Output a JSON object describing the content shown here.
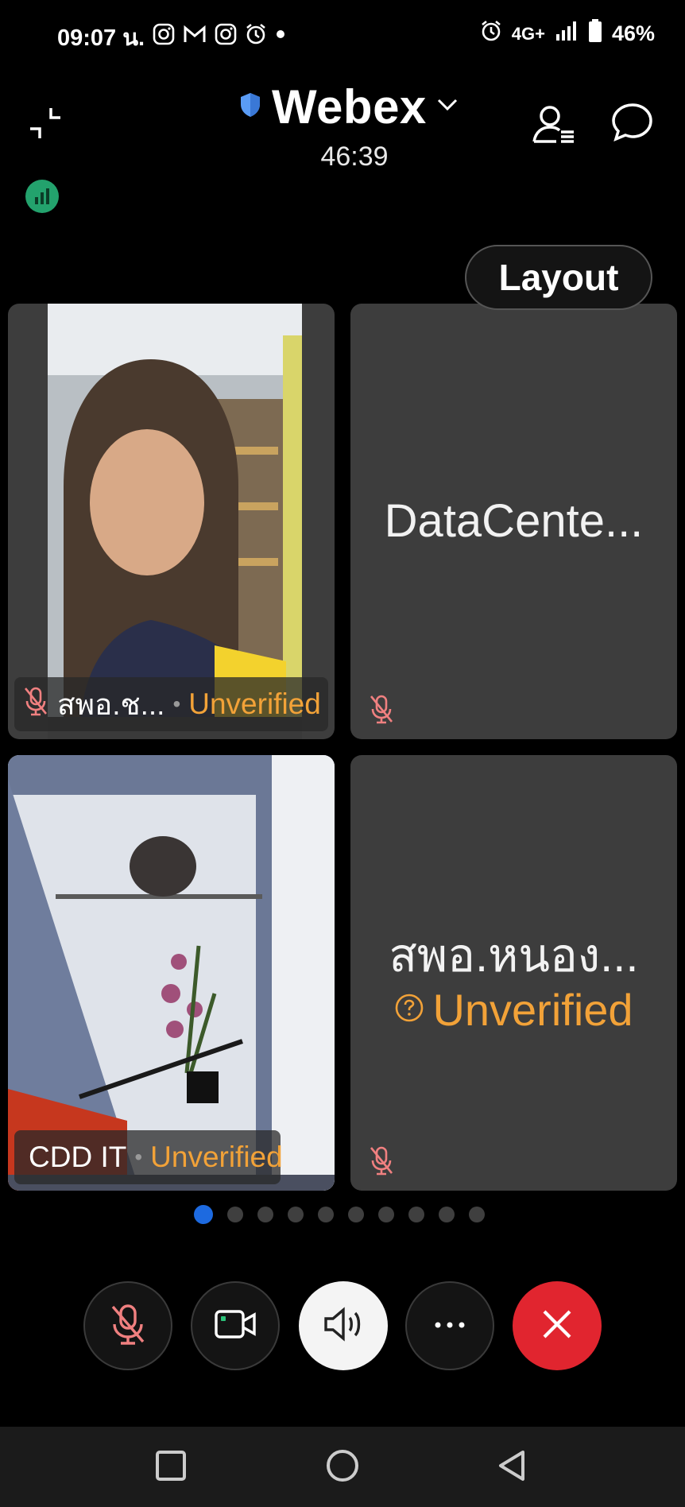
{
  "status_bar": {
    "time": "09:07 น.",
    "network": "4G+",
    "battery": "46%"
  },
  "header": {
    "app_name": "Webex",
    "timer": "46:39"
  },
  "layout_button": "Layout",
  "tiles": [
    {
      "name": "สพอ.ช...",
      "badge": "Unverified"
    },
    {
      "name": "DataCente..."
    },
    {
      "name": "CDD IT",
      "badge": "Unverified"
    },
    {
      "name": "สพอ.หนอง...",
      "badge": "Unverified"
    }
  ],
  "pagination": {
    "pages": 10,
    "current": 1
  },
  "colors": {
    "accent": "#1d6ae0",
    "unverified": "#f2a238",
    "end_call": "#e1252f",
    "network_ok": "#23a26d"
  },
  "controls": [
    "mute-toggle",
    "video-toggle",
    "speaker",
    "more",
    "end-call"
  ]
}
